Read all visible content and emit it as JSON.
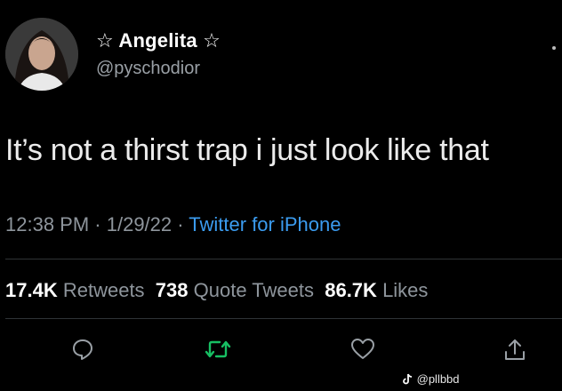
{
  "user": {
    "display_name": "☆ Angelita ☆",
    "handle": "@pyschodior"
  },
  "tweet": {
    "text": "It’s not a thirst trap i just look like that",
    "time": "12:38 PM",
    "date": "1/29/22",
    "sep1": " · ",
    "sep2": " · ",
    "source": "Twitter for iPhone"
  },
  "stats": {
    "retweets_count": "17.4K",
    "retweets_label": "Retweets",
    "quotes_count": "738",
    "quotes_label": "Quote Tweets",
    "likes_count": "86.7K",
    "likes_label": "Likes"
  },
  "actions": [
    {
      "icon": "reply-icon"
    },
    {
      "icon": "retweet-icon",
      "color": "#17bf63"
    },
    {
      "icon": "like-icon"
    },
    {
      "icon": "share-icon"
    }
  ],
  "watermark": {
    "icon": "tiktok-icon",
    "text": "@pllbbd"
  },
  "colors": {
    "background": "#000000",
    "link": "#3b9cf0",
    "muted": "#8e959c",
    "retweet": "#17bf63"
  }
}
